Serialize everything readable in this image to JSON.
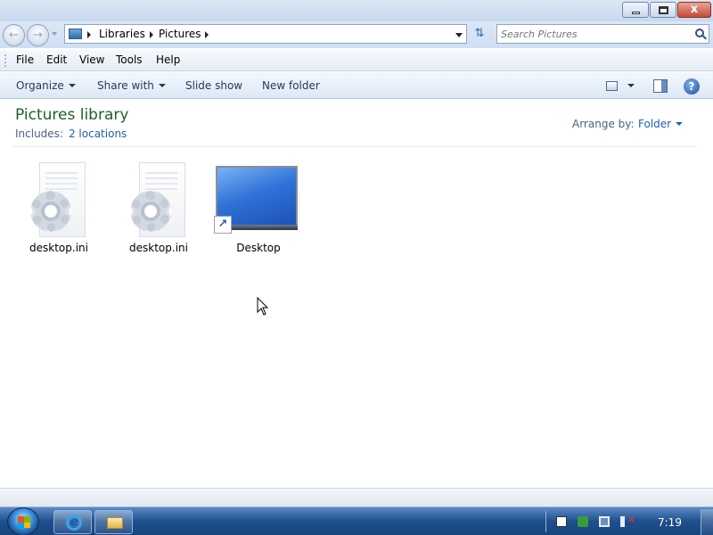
{
  "window": {
    "controls": {
      "minimize_icon": "minimize-icon",
      "maximize_icon": "restore-icon",
      "close_icon": "close-icon",
      "close_glyph": "x"
    }
  },
  "navigation": {
    "back_icon": "back-arrow-icon",
    "forward_icon": "forward-arrow-icon",
    "address": {
      "icon": "library-folder-icon",
      "crumbs": [
        "Libraries",
        "Pictures"
      ]
    },
    "refresh_icon": "refresh-icon",
    "search": {
      "placeholder": "Search Pictures",
      "value": ""
    }
  },
  "menu": {
    "items": [
      "File",
      "Edit",
      "View",
      "Tools",
      "Help"
    ]
  },
  "commands": {
    "organize": "Organize",
    "share_with": "Share with",
    "slide_show": "Slide show",
    "new_folder": "New folder",
    "help_glyph": "?"
  },
  "library": {
    "title": "Pictures library",
    "includes_label": "Includes:",
    "includes_link": "2 locations",
    "arrange_label": "Arrange by:",
    "arrange_value": "Folder"
  },
  "files": [
    {
      "name": "desktop.ini",
      "icon": "settings-file-icon"
    },
    {
      "name": "desktop.ini",
      "icon": "settings-file-icon"
    },
    {
      "name": "Desktop",
      "icon": "desktop-shortcut-icon"
    }
  ],
  "taskbar": {
    "start_icon": "windows-start-icon",
    "pinned": [
      {
        "icon": "internet-explorer-icon",
        "glyph": "e"
      },
      {
        "icon": "windows-explorer-icon"
      }
    ],
    "tray": {
      "icons": [
        "action-center-icon",
        "security-icon",
        "network-icon",
        "volume-muted-icon"
      ],
      "clock": "7:19"
    }
  },
  "colors": {
    "title_green": "#1e5f2e",
    "link_blue": "#1f5fb5",
    "taskbar_blue": "#1f4f8d"
  }
}
